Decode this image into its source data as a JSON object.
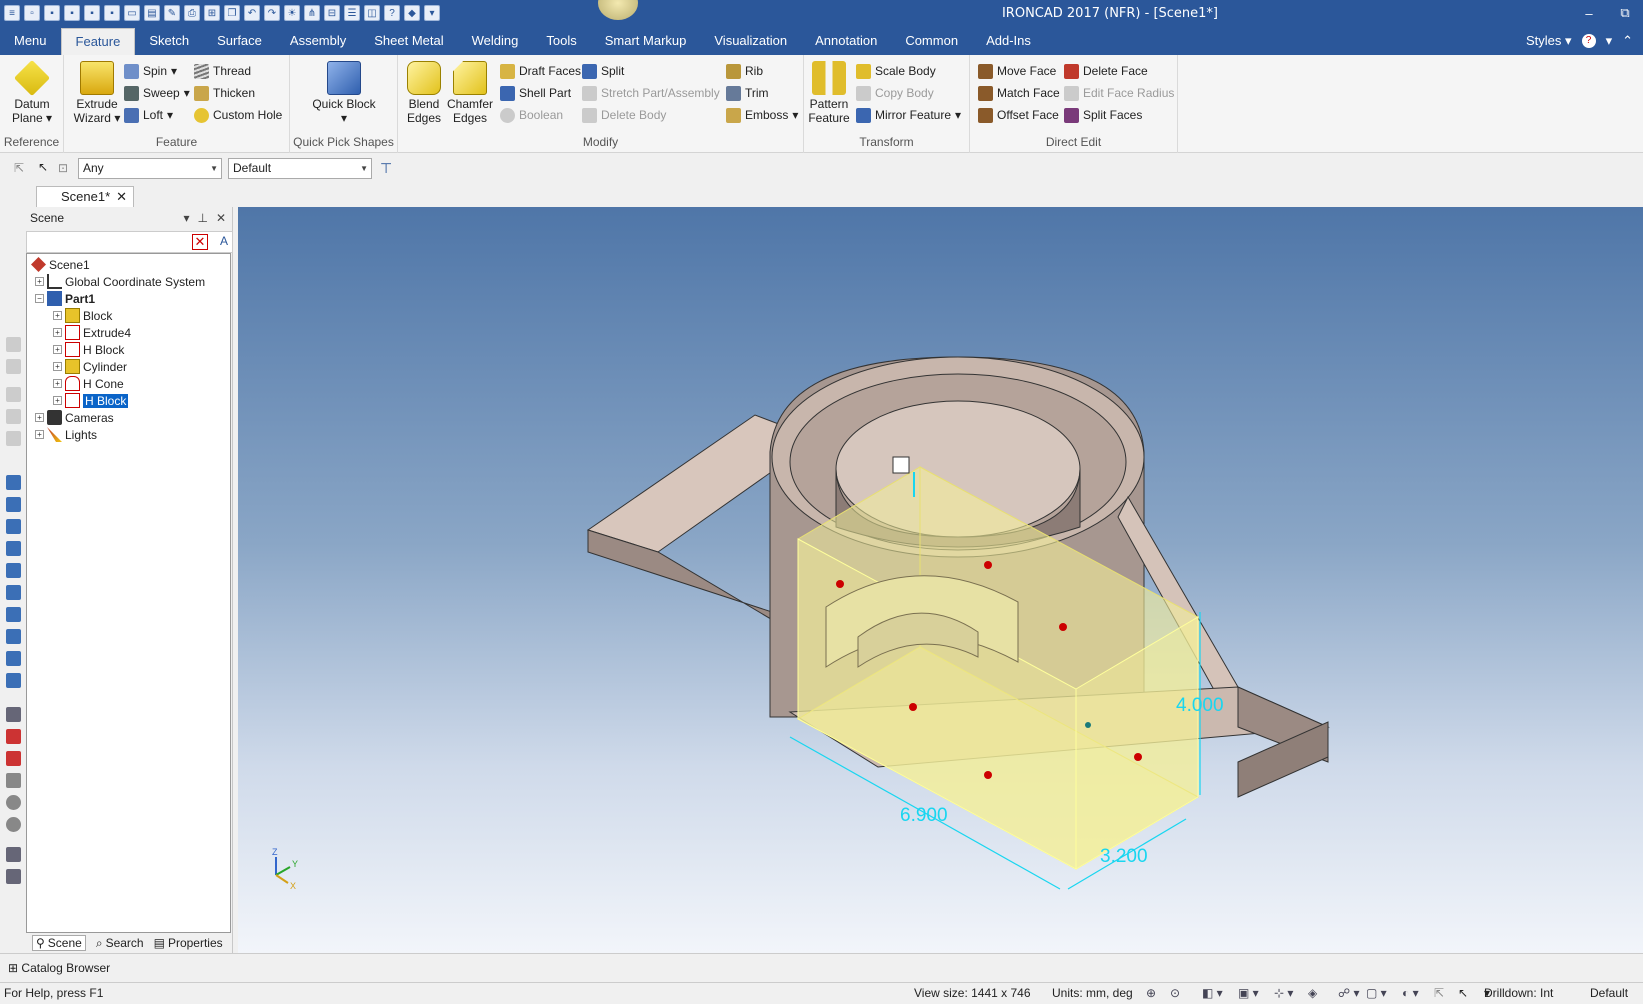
{
  "window": {
    "title": "IRONCAD 2017 (NFR) - [Scene1*]",
    "minimize": "–",
    "restore": "⧉"
  },
  "menu": {
    "tabs": [
      "Menu",
      "Feature",
      "Sketch",
      "Surface",
      "Assembly",
      "Sheet Metal",
      "Welding",
      "Tools",
      "Smart Markup",
      "Visualization",
      "Annotation",
      "Common",
      "Add-Ins"
    ],
    "active": "Feature",
    "styles_label": "Styles"
  },
  "ribbon": {
    "reference": {
      "label": "Reference",
      "datum_plane": "Datum Plane"
    },
    "feature": {
      "label": "Feature",
      "extrude_wizard": "Extrude Wizard",
      "spin": "Spin",
      "sweep": "Sweep",
      "loft": "Loft",
      "thread": "Thread",
      "thicken": "Thicken",
      "custom_hole": "Custom Hole"
    },
    "quick_pick": {
      "label": "Quick Pick Shapes",
      "quick_block": "Quick Block"
    },
    "modify": {
      "label": "Modify",
      "blend_edges": "Blend Edges",
      "chamfer_edges": "Chamfer Edges",
      "draft_faces": "Draft Faces",
      "shell_part": "Shell Part",
      "boolean": "Boolean",
      "split": "Split",
      "stretch": "Stretch Part/Assembly",
      "delete_body": "Delete Body",
      "rib": "Rib",
      "trim": "Trim",
      "emboss": "Emboss"
    },
    "transform": {
      "label": "Transform",
      "pattern_feature": "Pattern Feature",
      "scale_body": "Scale Body",
      "copy_body": "Copy Body",
      "mirror_feature": "Mirror Feature"
    },
    "direct_edit": {
      "label": "Direct Edit",
      "move_face": "Move Face",
      "match_face": "Match Face",
      "offset_face": "Offset Face",
      "delete_face": "Delete Face",
      "edit_face_radius": "Edit Face Radius",
      "split_faces": "Split Faces"
    }
  },
  "toolbar": {
    "selection_filter": "Any",
    "style_combo": "Default"
  },
  "doc_tab": {
    "label": "Scene1*"
  },
  "scene_panel": {
    "title": "Scene",
    "tree": [
      {
        "label": "Scene1",
        "level": 0
      },
      {
        "label": "Global Coordinate System",
        "level": 1
      },
      {
        "label": "Part1",
        "level": 1
      },
      {
        "label": "Block",
        "level": 2
      },
      {
        "label": "Extrude4",
        "level": 2
      },
      {
        "label": "H Block",
        "level": 2
      },
      {
        "label": "Cylinder",
        "level": 2
      },
      {
        "label": "H Cone",
        "level": 2
      },
      {
        "label": "H Block",
        "level": 2
      },
      {
        "label": "Cameras",
        "level": 1
      },
      {
        "label": "Lights",
        "level": 1
      }
    ],
    "tabs": [
      "Scene",
      "Search",
      "Properties"
    ]
  },
  "viewport": {
    "dim_length": "6.900",
    "dim_width": "3.200",
    "dim_height": "4.000",
    "axis_z": "Z",
    "axis_y": "Y",
    "axis_x": "X"
  },
  "catalog_browser": "Catalog Browser",
  "status": {
    "help": "For Help, press F1",
    "view_size": "View size: 1441 x  746",
    "units": "Units: mm, deg",
    "drilldown": "Drilldown: Int",
    "mode": "Default"
  },
  "colors": {
    "accent": "#2b579a",
    "selection_box": "#f3ef9a",
    "dimension": "#18d6f0"
  }
}
